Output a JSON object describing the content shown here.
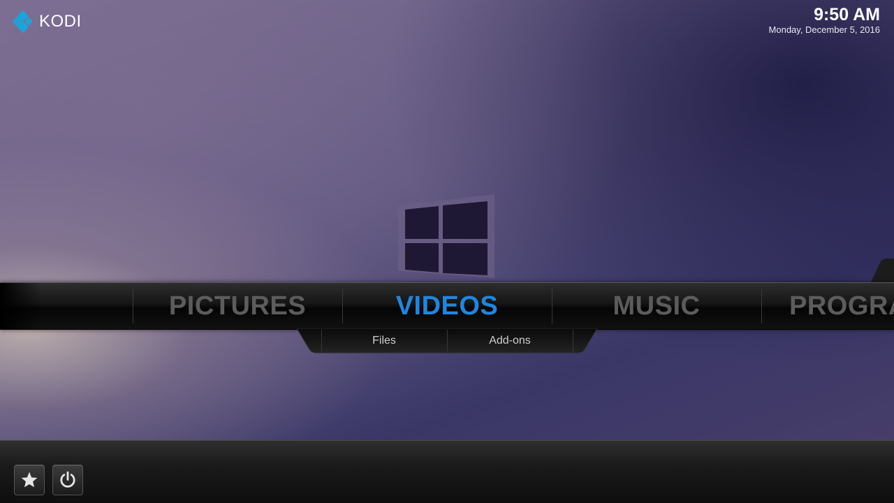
{
  "app": {
    "logo_text": "KODI"
  },
  "clock": {
    "time": "9:50 AM",
    "date": "Monday, December 5, 2016"
  },
  "main_menu": {
    "items": [
      {
        "label": "PICTURES",
        "active": false
      },
      {
        "label": "VIDEOS",
        "active": true
      },
      {
        "label": "MUSIC",
        "active": false
      },
      {
        "label": "PROGRA",
        "active": false
      }
    ]
  },
  "submenu": {
    "items": [
      {
        "label": "Files"
      },
      {
        "label": "Add-ons"
      }
    ]
  },
  "bottom_bar": {
    "buttons": [
      {
        "icon": "star-icon"
      },
      {
        "icon": "power-icon"
      }
    ]
  },
  "colors": {
    "accent": "#1f86e0",
    "inactive_menu": "#5c5c5c",
    "logo_blue": "#17a7dc"
  }
}
